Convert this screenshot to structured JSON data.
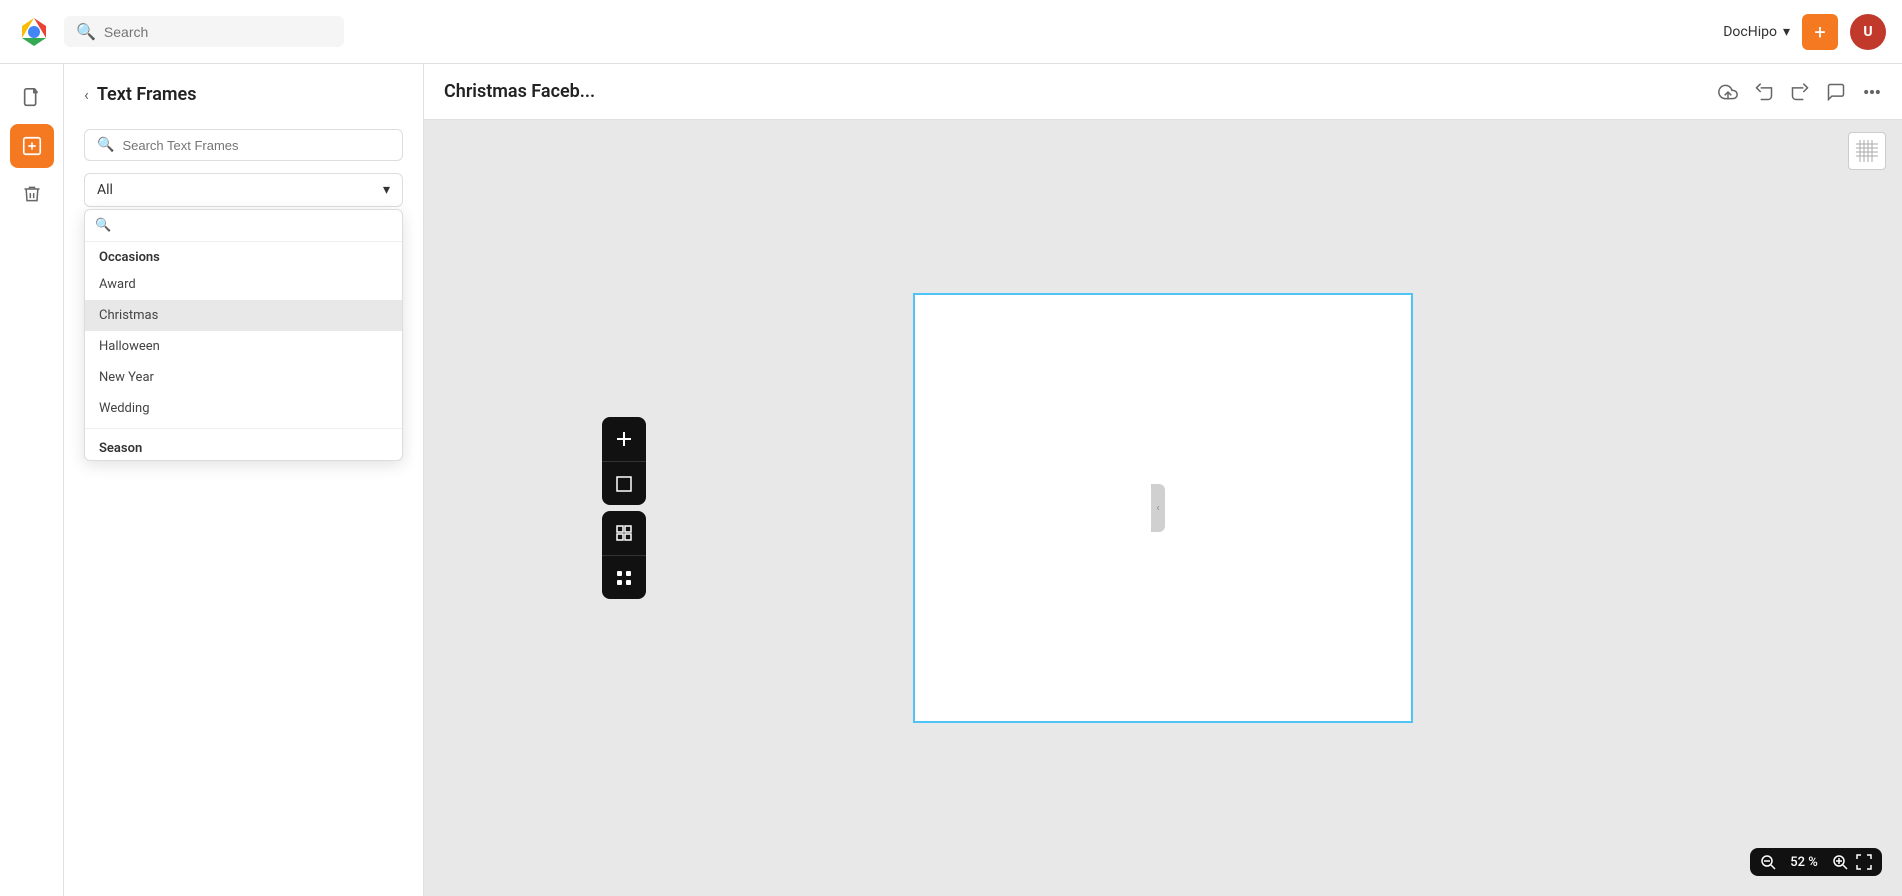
{
  "topbar": {
    "search_placeholder": "Search",
    "dochipo_label": "DocHipo",
    "add_label": "+",
    "avatar_initials": "U"
  },
  "icon_sidebar": {
    "items": [
      {
        "id": "document",
        "icon": "📄",
        "label": "document-icon"
      },
      {
        "id": "text-frames",
        "icon": "📝",
        "label": "text-frames-icon",
        "active": true
      },
      {
        "id": "delete",
        "icon": "🗑",
        "label": "delete-icon"
      }
    ]
  },
  "panel": {
    "back_label": "‹",
    "title": "Text Frames",
    "search_placeholder": "Search Text Frames",
    "dropdown": {
      "selected": "All",
      "options": [
        "All",
        "Occasions",
        "Season"
      ],
      "search_placeholder": ""
    },
    "dropdown_menu": {
      "group1_label": "Occasions",
      "group1_items": [
        "Award",
        "Christmas",
        "Halloween",
        "New Year",
        "Wedding"
      ],
      "group2_label": "Season",
      "group2_items": [],
      "selected_item": "Christmas"
    }
  },
  "canvas": {
    "doc_title": "Christmas Faceb...",
    "zoom_value": "52 %",
    "zoom_minus": "−",
    "zoom_plus": "+"
  },
  "float_toolbar": {
    "btn1_icon": "+",
    "btn2_icon": "⊡",
    "btn3_icon": "⊞",
    "btn4_icon": "⊟"
  }
}
